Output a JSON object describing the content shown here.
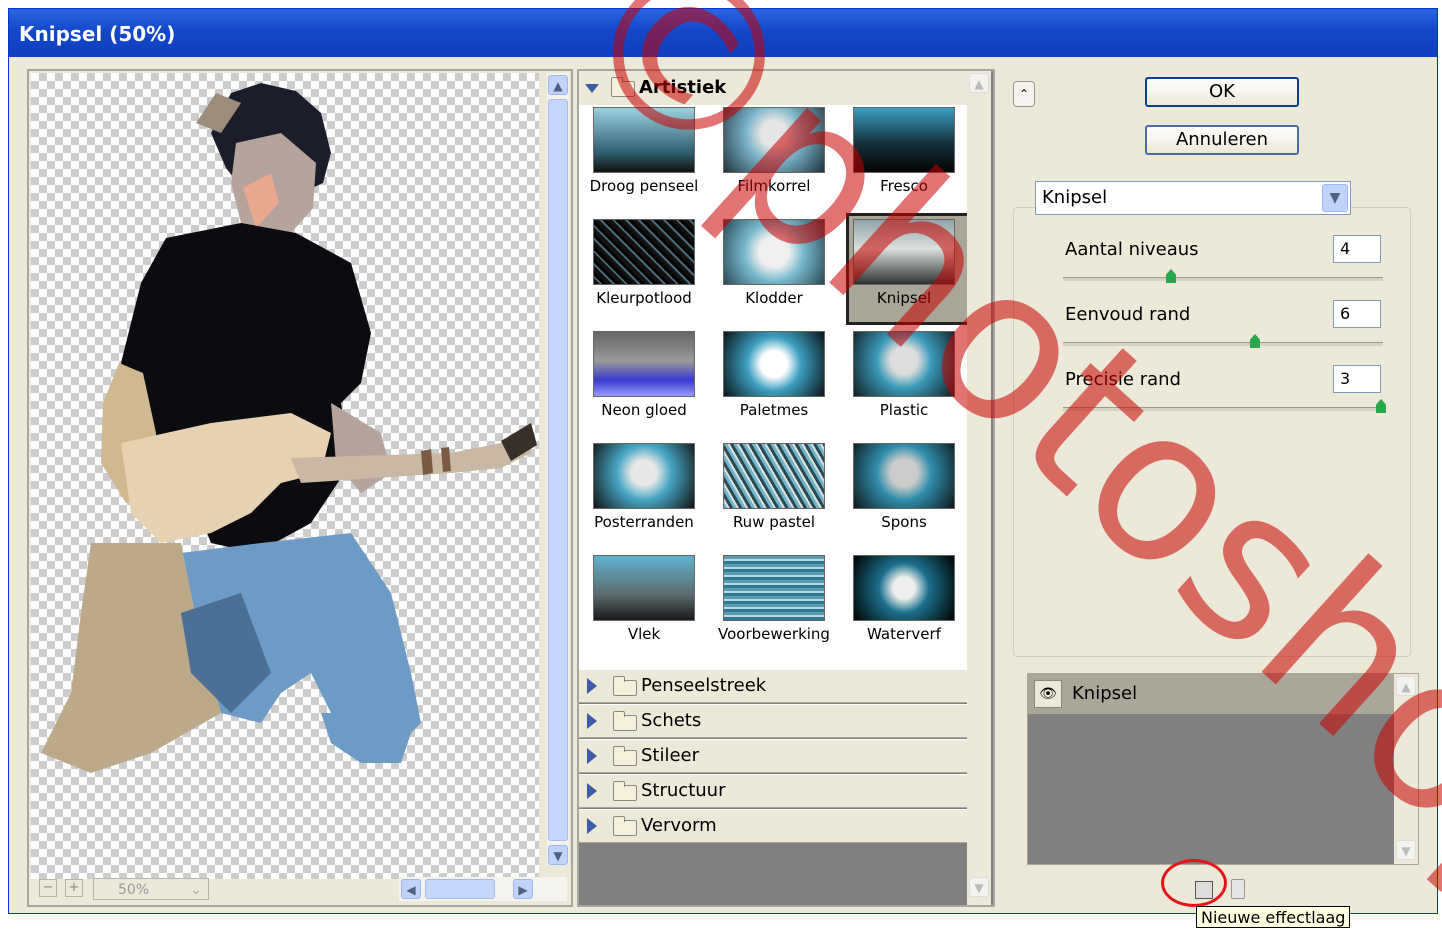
{
  "window": {
    "title": "Knipsel (50%)"
  },
  "preview": {
    "zoom": "50%",
    "zoom_out": "−",
    "zoom_in": "+"
  },
  "gallery": {
    "open_category": "Artistiek",
    "filters": [
      "Droog penseel",
      "Filmkorrel",
      "Fresco",
      "Kleurpotlood",
      "Klodder",
      "Knipsel",
      "Neon gloed",
      "Paletmes",
      "Plastic",
      "Posterranden",
      "Ruw pastel",
      "Spons",
      "Vlek",
      "Voorbewerking",
      "Waterverf"
    ],
    "selected_filter": "Knipsel",
    "categories": [
      "Penseelstreek",
      "Schets",
      "Stileer",
      "Structuur",
      "Vervorm"
    ]
  },
  "buttons": {
    "ok": "OK",
    "cancel": "Annuleren"
  },
  "settings": {
    "filter_select": "Knipsel",
    "params": [
      {
        "label": "Aantal niveaus",
        "value": "4"
      },
      {
        "label": "Eenvoud rand",
        "value": "6"
      },
      {
        "label": "Precisie rand",
        "value": "3"
      }
    ]
  },
  "layers": {
    "items": [
      {
        "name": "Knipsel"
      }
    ]
  },
  "tooltip": "Nieuwe effectlaag",
  "watermark": "©photoshop",
  "colors": {
    "title_bar": "#1447c9",
    "panel_bg": "#ece9d8",
    "accent_red": "#e51515"
  }
}
